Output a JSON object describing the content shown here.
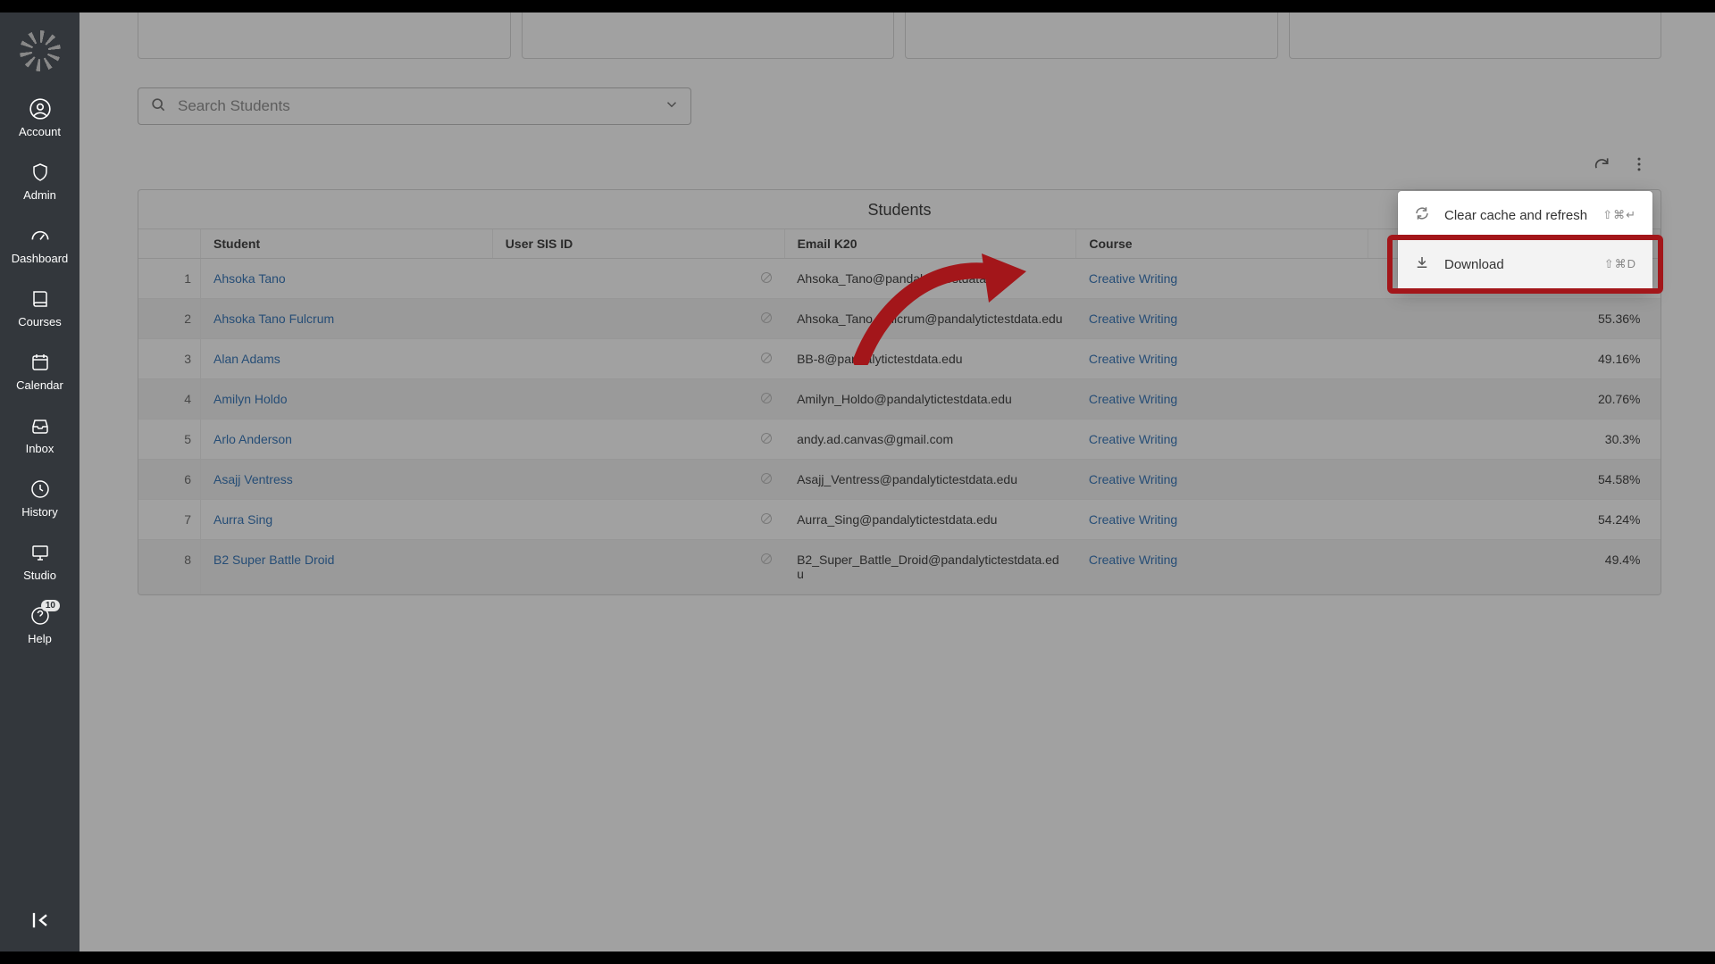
{
  "sidebar": {
    "items": [
      {
        "label": "Account"
      },
      {
        "label": "Admin"
      },
      {
        "label": "Dashboard"
      },
      {
        "label": "Courses"
      },
      {
        "label": "Calendar"
      },
      {
        "label": "Inbox"
      },
      {
        "label": "History"
      },
      {
        "label": "Studio"
      },
      {
        "label": "Help",
        "badge": "10"
      }
    ]
  },
  "search": {
    "placeholder": "Search Students"
  },
  "table": {
    "title": "Students",
    "headers": {
      "student": "Student",
      "sis": "User SIS ID",
      "email": "Email K20",
      "course": "Course"
    },
    "rows": [
      {
        "n": "1",
        "student": "Ahsoka Tano",
        "email": "Ahsoka_Tano@pandalytictestdata.edu",
        "course": "Creative Writing",
        "score": ""
      },
      {
        "n": "2",
        "student": "Ahsoka Tano Fulcrum",
        "email": "Ahsoka_Tano_Fulcrum@pandalytictestdata.edu",
        "course": "Creative Writing",
        "score": "55.36%"
      },
      {
        "n": "3",
        "student": "Alan Adams",
        "email": "BB-8@pandalytictestdata.edu",
        "course": "Creative Writing",
        "score": "49.16%"
      },
      {
        "n": "4",
        "student": "Amilyn Holdo",
        "email": "Amilyn_Holdo@pandalytictestdata.edu",
        "course": "Creative Writing",
        "score": "20.76%"
      },
      {
        "n": "5",
        "student": "Arlo Anderson",
        "email": "andy.ad.canvas@gmail.com",
        "course": "Creative Writing",
        "score": "30.3%"
      },
      {
        "n": "6",
        "student": "Asajj Ventress",
        "email": "Asajj_Ventress@pandalytictestdata.edu",
        "course": "Creative Writing",
        "score": "54.58%"
      },
      {
        "n": "7",
        "student": "Aurra Sing",
        "email": "Aurra_Sing@pandalytictestdata.edu",
        "course": "Creative Writing",
        "score": "54.24%"
      },
      {
        "n": "8",
        "student": "B2 Super Battle Droid",
        "email": "B2_Super_Battle_Droid@pandalytictestdata.edu",
        "course": "Creative Writing",
        "score": "49.4%"
      }
    ]
  },
  "menu": {
    "clear": {
      "label": "Clear cache and refresh",
      "shortcut": "⇧⌘↵"
    },
    "download": {
      "label": "Download",
      "shortcut": "⇧⌘D"
    }
  },
  "colors": {
    "link": "#2b6fb5",
    "accent": "#a3161a"
  }
}
